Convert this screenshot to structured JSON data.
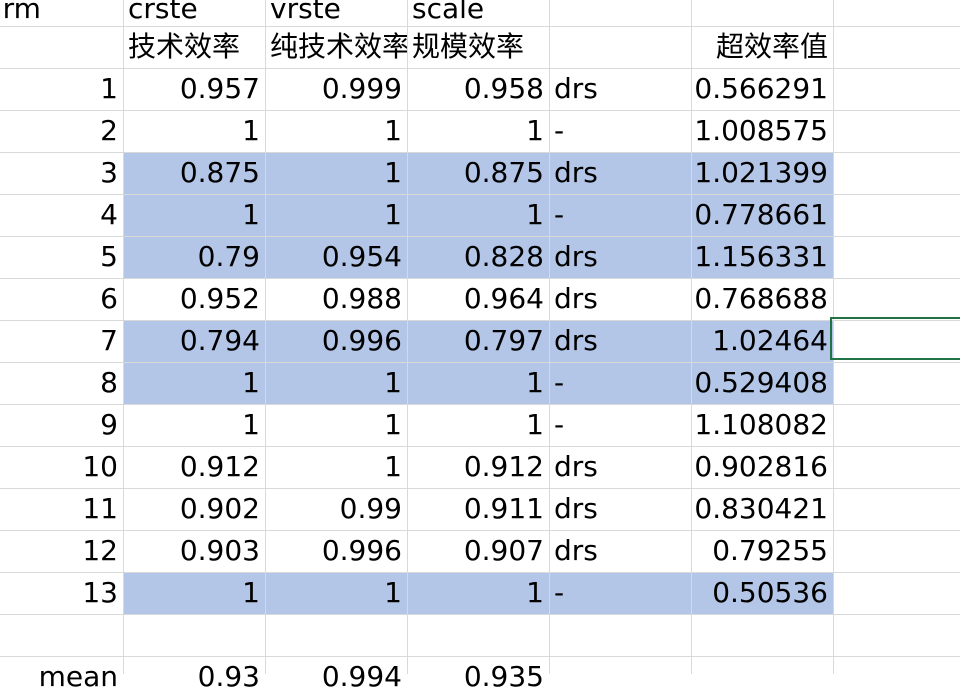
{
  "sheet": {
    "top_row": {
      "a": "firm",
      "b": "crste",
      "c": "vrste",
      "d": "scale"
    },
    "header_row": {
      "b": "技术效率",
      "c": "纯技术效率",
      "d": "规模效率",
      "f": "超效率值"
    },
    "rows": [
      {
        "a": "1",
        "b": "0.957",
        "c": "0.999",
        "d": "0.958",
        "e": "drs",
        "f": "0.566291",
        "highlight": false
      },
      {
        "a": "2",
        "b": "1",
        "c": "1",
        "d": "1",
        "e": "-",
        "f": "1.008575",
        "highlight": false
      },
      {
        "a": "3",
        "b": "0.875",
        "c": "1",
        "d": "0.875",
        "e": "drs",
        "f": "1.021399",
        "highlight": true
      },
      {
        "a": "4",
        "b": "1",
        "c": "1",
        "d": "1",
        "e": "-",
        "f": "0.778661",
        "highlight": true
      },
      {
        "a": "5",
        "b": "0.79",
        "c": "0.954",
        "d": "0.828",
        "e": "drs",
        "f": "1.156331",
        "highlight": true
      },
      {
        "a": "6",
        "b": "0.952",
        "c": "0.988",
        "d": "0.964",
        "e": "drs",
        "f": "0.768688",
        "highlight": false
      },
      {
        "a": "7",
        "b": "0.794",
        "c": "0.996",
        "d": "0.797",
        "e": "drs",
        "f": "1.02464",
        "highlight": true
      },
      {
        "a": "8",
        "b": "1",
        "c": "1",
        "d": "1",
        "e": "-",
        "f": "0.529408",
        "highlight": true
      },
      {
        "a": "9",
        "b": "1",
        "c": "1",
        "d": "1",
        "e": "-",
        "f": "1.108082",
        "highlight": false
      },
      {
        "a": "10",
        "b": "0.912",
        "c": "1",
        "d": "0.912",
        "e": "drs",
        "f": "0.902816",
        "highlight": false
      },
      {
        "a": "11",
        "b": "0.902",
        "c": "0.99",
        "d": "0.911",
        "e": "drs",
        "f": "0.830421",
        "highlight": false
      },
      {
        "a": "12",
        "b": "0.903",
        "c": "0.996",
        "d": "0.907",
        "e": "drs",
        "f": "0.79255",
        "highlight": false
      },
      {
        "a": "13",
        "b": "1",
        "c": "1",
        "d": "1",
        "e": "-",
        "f": "0.50536",
        "highlight": true
      }
    ],
    "bottom_row": {
      "a": "mean",
      "b": "0.93",
      "c": "0.994",
      "d": "0.935"
    },
    "colors": {
      "highlight": "#b4c6e7",
      "gridline": "#d9d9d9",
      "selection": "#217346"
    }
  }
}
